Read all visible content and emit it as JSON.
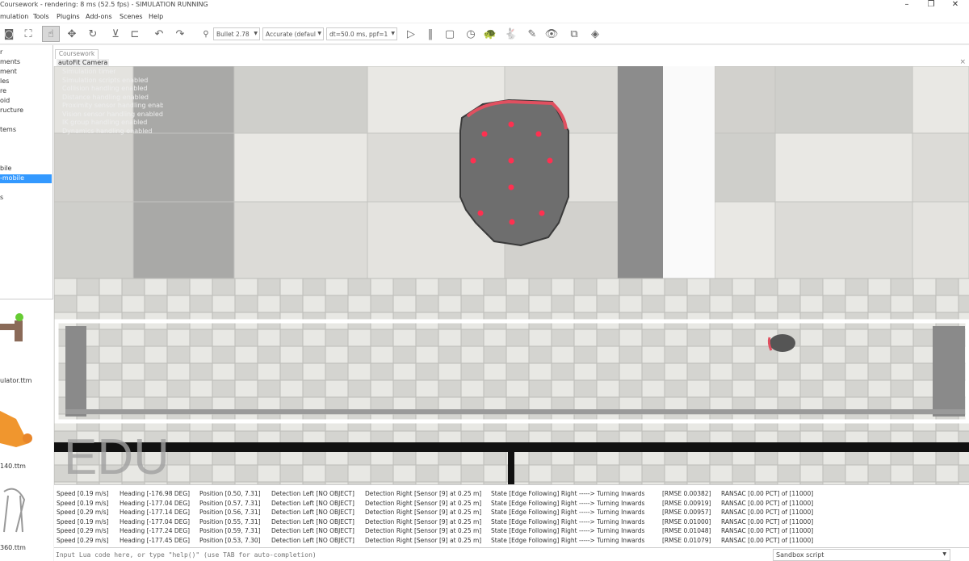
{
  "window": {
    "title": "Coursework - rendering: 8 ms (52.5 fps) - SIMULATION RUNNING",
    "minimize": "–",
    "restore": "❐",
    "close": "✕"
  },
  "menu": [
    "mulation",
    "Tools",
    "Plugins",
    "Add-ons",
    "Scenes",
    "Help"
  ],
  "toolbar": {
    "icons": [
      "camera-pan-icon",
      "camera-fit-icon",
      "object-select-icon",
      "object-shift-icon",
      "object-rotate-icon",
      "assemble-icon",
      "transfer-dna-icon",
      "undo-icon",
      "redo-icon"
    ],
    "engine": "Bullet 2.78",
    "accuracy": "Accurate (defaul",
    "timestep": "dt=50.0 ms, ppf=1",
    "sim_icons": [
      "play-icon",
      "pause-icon",
      "stop-icon",
      "realtime-icon",
      "slow-down-icon",
      "speed-up-icon",
      "thread-rendering-icon",
      "visualization-icon",
      "page-selector-icon",
      "scene-selector-icon"
    ]
  },
  "hierarchy": [
    "r",
    "ments",
    "ment",
    "les",
    "re",
    "oid",
    "ructure",
    "tems",
    "bile",
    "-mobile",
    "s"
  ],
  "hierarchy_selected": "-mobile",
  "models": [
    "ulator.ttm",
    "140.ttm",
    "360.ttm"
  ],
  "tab": "Coursework",
  "viewport": {
    "camera_label": "autoFit Camera",
    "overlay": [
      "Simulation timer",
      "Simulation scripts enabled",
      "Collision handling enabled",
      "Distance handling enabled",
      "Proximity sensor handling enabled",
      "Vision sensor handling enabled",
      "IK group handling enabled",
      "Dynamics handling enabled"
    ],
    "watermark": "EDU",
    "close": "×"
  },
  "console": [
    [
      "Speed [0.19 m/s]",
      "Heading [-176.98 DEG]",
      "Position [0.50, 7.31]",
      "Detection Left [NO OBJECT]",
      "Detection Right [Sensor [9] at 0.25 m]",
      "State [Edge Following] Right -----> Turning Inwards",
      "[RMSE 0.00382]",
      "RANSAC [0.00 PCT] of [11000]"
    ],
    [
      "Speed [0.19 m/s]",
      "Heading [-177.04 DEG]",
      "Position [0.57, 7.31]",
      "Detection Left [NO OBJECT]",
      "Detection Right [Sensor [9] at 0.25 m]",
      "State [Edge Following] Right -----> Turning Inwards",
      "[RMSE 0.00919]",
      "RANSAC [0.00 PCT] of [11000]"
    ],
    [
      "Speed [0.29 m/s]",
      "Heading [-177.14 DEG]",
      "Position [0.56, 7.31]",
      "Detection Left [NO OBJECT]",
      "Detection Right [Sensor [9] at 0.25 m]",
      "State [Edge Following] Right -----> Turning Inwards",
      "[RMSE 0.00957]",
      "RANSAC [0.00 PCT] of [11000]"
    ],
    [
      "Speed [0.19 m/s]",
      "Heading [-177.04 DEG]",
      "Position [0.55, 7.31]",
      "Detection Left [NO OBJECT]",
      "Detection Right [Sensor [9] at 0.25 m]",
      "State [Edge Following] Right -----> Turning Inwards",
      "[RMSE 0.01000]",
      "RANSAC [0.00 PCT] of [11000]"
    ],
    [
      "Speed [0.29 m/s]",
      "Heading [-177.24 DEG]",
      "Position [0.59, 7.31]",
      "Detection Left [NO OBJECT]",
      "Detection Right [Sensor [9] at 0.25 m]",
      "State [Edge Following] Right -----> Turning Inwards",
      "[RMSE 0.01048]",
      "RANSAC [0.00 PCT] of [11000]"
    ],
    [
      "Speed [0.29 m/s]",
      "Heading [-177.45 DEG]",
      "Position [0.53, 7.30]",
      "Detection Left [NO OBJECT]",
      "Detection Right [Sensor [9] at 0.25 m]",
      "State [Edge Following] Right -----> Turning Inwards",
      "[RMSE 0.01079]",
      "RANSAC [0.00 PCT] of [11000]"
    ]
  ],
  "input": {
    "placeholder": "Input Lua code here, or type \"help()\" (use TAB for auto-completion)",
    "script": "Sandbox script"
  },
  "colors": {
    "selection": "#3399ff",
    "robot_body": "#6e6e6e",
    "sensor": "#ff3050",
    "bumper": "#e05060"
  }
}
